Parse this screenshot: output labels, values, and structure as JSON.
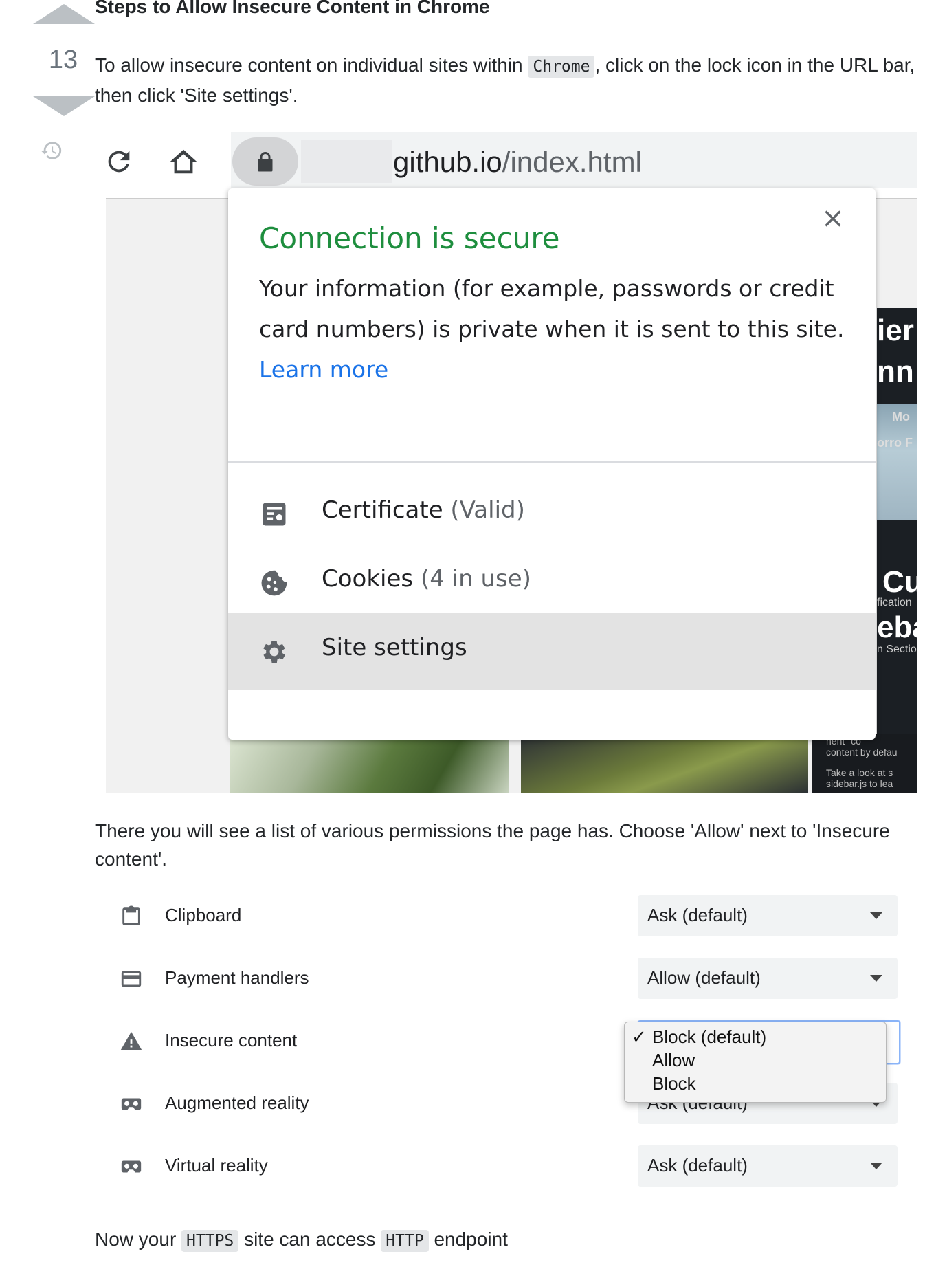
{
  "vote": {
    "count": "13"
  },
  "heading": "Steps to Allow Insecure Content in Chrome",
  "intro": {
    "before": "To allow insecure content on individual sites within ",
    "code": "Chrome",
    "after": ", click on the lock icon in the URL bar, then click 'Site settings'."
  },
  "browser": {
    "url_domain": "github.io",
    "url_path": "/index.html",
    "side_texts": [
      "ier",
      "nn",
      "Mo",
      "orro F",
      "Cu",
      "fication",
      "eba",
      "n Sectio",
      "nent \"co",
      "content by defau",
      "Take a look at s",
      "sidebar.js to lea"
    ]
  },
  "popup": {
    "title": "Connection is secure",
    "body": "Your information (for example, passwords or credit card numbers) is private when it is sent to this site.",
    "learn_more": "Learn more",
    "items": [
      {
        "label": "Certificate",
        "detail": "(Valid)",
        "icon": "certificate-icon"
      },
      {
        "label": "Cookies",
        "detail": "(4 in use)",
        "icon": "cookie-icon"
      },
      {
        "label": "Site settings",
        "detail": "",
        "icon": "gear-icon"
      }
    ]
  },
  "middle_text": "There you will see a list of various permissions the page has. Choose 'Allow' next to 'Insecure content'.",
  "permissions": [
    {
      "label": "Clipboard",
      "value": "Ask (default)",
      "icon": "clipboard-icon"
    },
    {
      "label": "Payment handlers",
      "value": "Allow (default)",
      "icon": "payment-card-icon"
    },
    {
      "label": "Insecure content",
      "value": "",
      "icon": "warning-icon"
    },
    {
      "label": "Augmented reality",
      "value": "Ask (default)",
      "icon": "vr-headset-icon"
    },
    {
      "label": "Virtual reality",
      "value": "Ask (default)",
      "icon": "vr-headset-icon"
    }
  ],
  "dropdown": {
    "checkmark": "✓",
    "options": [
      "Block (default)",
      "Allow",
      "Block"
    ]
  },
  "final": {
    "before": "Now your ",
    "code1": "HTTPS",
    "middle": " site can access ",
    "code2": "HTTP",
    "after": " endpoint"
  }
}
